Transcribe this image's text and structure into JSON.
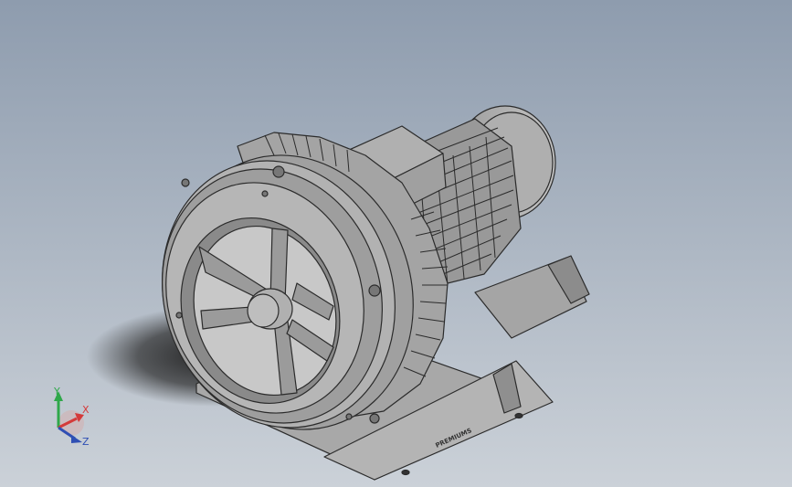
{
  "viewport": {
    "background_top": "#8E9CAE",
    "background_bottom": "#C9CFD6"
  },
  "model": {
    "name": "side-channel-blower",
    "body_color": "#9A9A9A",
    "edge_color": "#2B2B2B",
    "logo_text": "PREMIUMS"
  },
  "triad": {
    "x_label": "X",
    "y_label": "Y",
    "z_label": "Z",
    "x_color": "#D43A3A",
    "y_color": "#2FA84A",
    "z_color": "#2F4FB4"
  }
}
